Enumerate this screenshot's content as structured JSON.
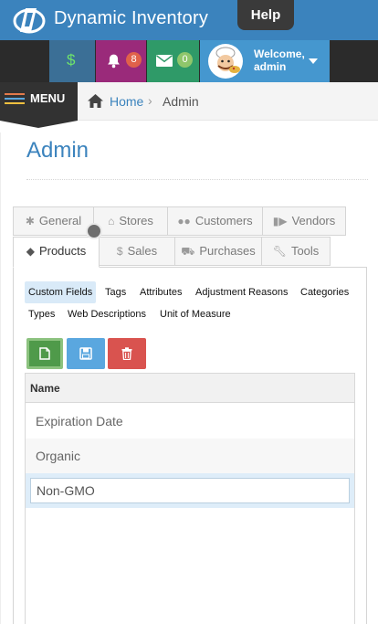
{
  "header": {
    "brand": "Dynamic Inventory",
    "help_label": "Help"
  },
  "notifications": {
    "dollar_glyph": "$",
    "alerts_count": "8",
    "messages_count": "0",
    "welcome_line": "Welcome,",
    "user_name": "admin"
  },
  "nav": {
    "menu_label": "MENU",
    "breadcrumb": {
      "home": "Home",
      "separator": "›",
      "current": "Admin"
    }
  },
  "page": {
    "title": "Admin"
  },
  "tabs_row1": [
    {
      "label": "General",
      "icon": "gear-icon"
    },
    {
      "label": "Stores",
      "icon": "home-icon"
    },
    {
      "label": "Customers",
      "icon": "users-icon"
    },
    {
      "label": "Vendors",
      "icon": "truck-icon"
    }
  ],
  "tabs_row2": [
    {
      "label": "Products",
      "icon": "tags-icon",
      "active": true
    },
    {
      "label": "Sales",
      "icon": "dollar-icon"
    },
    {
      "label": "Purchases",
      "icon": "cart-icon"
    },
    {
      "label": "Tools",
      "icon": "wrench-icon"
    }
  ],
  "subtabs": [
    {
      "label": "Custom Fields",
      "active": true
    },
    {
      "label": "Tags"
    },
    {
      "label": "Attributes"
    },
    {
      "label": "Adjustment Reasons"
    },
    {
      "label": "Categories"
    },
    {
      "label": "Types"
    },
    {
      "label": "Web Descriptions"
    },
    {
      "label": "Unit of Measure"
    }
  ],
  "grid": {
    "header": "Name",
    "rows": [
      "Expiration Date",
      "Organic"
    ],
    "editing_value": "Non-GMO"
  },
  "colors": {
    "brand_blue": "#3b83bd",
    "alerts": "#9a2a7a",
    "messages": "#2f9a68",
    "new_button": "#4f9a4a",
    "save_button": "#5aa7df",
    "delete_button": "#d9534f"
  }
}
